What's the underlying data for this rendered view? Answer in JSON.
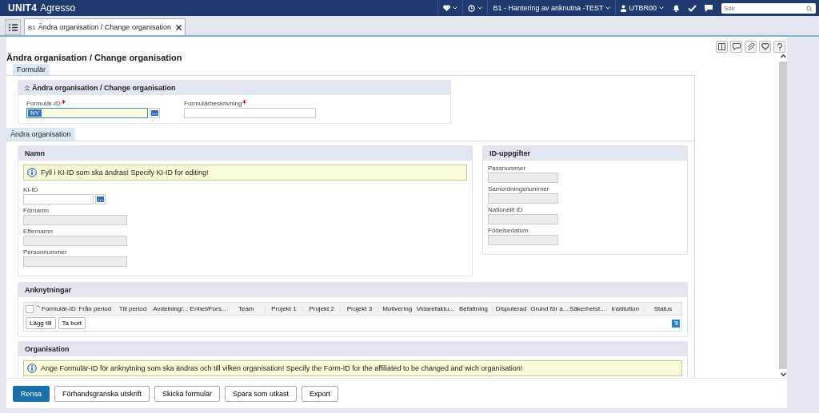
{
  "app": {
    "brand": "UNIT4",
    "product": "Agresso"
  },
  "topbar": {
    "context": "B1 - Hantering av anknutna -TEST",
    "user": "UTBR00",
    "search": {
      "placeholder": "Sök"
    }
  },
  "doc_tabs": [
    {
      "badge": "B1",
      "label": "Ändra organisation / Change organisation",
      "selected": true
    }
  ],
  "page_title": "Ändra organisation / Change organisation",
  "form_tabs": [
    {
      "label": "Formulär",
      "selected": true
    }
  ],
  "header_section": {
    "title": "Ändra organisation / Change organisation",
    "expanded": true,
    "fields": [
      {
        "label": "Formulär-ID",
        "required": true,
        "value": "NY",
        "lookup": true,
        "focused": true
      },
      {
        "label": "Formulärbeskrivning",
        "required": true,
        "lookup": false,
        "focused": false
      }
    ]
  },
  "inner_tabs": [
    {
      "label": "Ändra organisation",
      "selected": true
    }
  ],
  "namn": {
    "title": "Namn",
    "info": "Fyll i KI-ID som ska ändras! Specify KI-ID for editing!",
    "fields": [
      {
        "label": "KI-ID",
        "disabled": false,
        "lookup": true
      },
      {
        "label": "Förnamn",
        "disabled": true,
        "lookup": false
      },
      {
        "label": "Efternamn",
        "disabled": true,
        "lookup": false
      },
      {
        "label": "Personnummer",
        "disabled": true,
        "lookup": false
      }
    ]
  },
  "id_section": {
    "title": "ID-uppgifter",
    "fields": [
      {
        "label": "Passnummer",
        "disabled": true
      },
      {
        "label": "Samordningsnummer",
        "disabled": true
      },
      {
        "label": "Nationellt ID",
        "disabled": true
      },
      {
        "label": "Födelsedatum",
        "disabled": true
      }
    ]
  },
  "anknytningar": {
    "title": "Anknytningar",
    "columns": [
      {
        "label": "Formulär-ID",
        "sorted": true
      },
      {
        "label": "Från period",
        "sorted": false
      },
      {
        "label": "Till period",
        "sorted": false
      },
      {
        "label": "Avdelning/...",
        "sorted": false
      },
      {
        "label": "Enhet/Fors...",
        "sorted": false
      },
      {
        "label": "Team",
        "sorted": false
      },
      {
        "label": "Projekt 1",
        "sorted": false
      },
      {
        "label": "Projekt 2",
        "sorted": false
      },
      {
        "label": "Projekt 3",
        "sorted": false
      },
      {
        "label": "Motivering",
        "sorted": false
      },
      {
        "label": "Vidarefaktu...",
        "sorted": false
      },
      {
        "label": "Befattning",
        "sorted": false
      },
      {
        "label": "Disputerad",
        "sorted": false
      },
      {
        "label": "Grund för a...",
        "sorted": false
      },
      {
        "label": "Säkerhetst...",
        "sorted": false
      },
      {
        "label": "Institution",
        "sorted": false
      },
      {
        "label": "Status",
        "sorted": false
      }
    ],
    "select_all_checked": false,
    "buttons": [
      "Lägg till",
      "Ta bort"
    ]
  },
  "organisation": {
    "title": "Organisation",
    "info": "Ange Formulär-ID för anknytning som ska ändras och till vilken organisation! Specify the Form-ID for the affiliated to be changed and wich organisation!"
  },
  "actions": [
    {
      "label": "Rensa",
      "primary": true
    },
    {
      "label": "Förhandsgranska utskrift",
      "primary": false
    },
    {
      "label": "Skicka formulär",
      "primary": false
    },
    {
      "label": "Spara som utkast",
      "primary": false
    },
    {
      "label": "Export",
      "primary": false
    }
  ]
}
